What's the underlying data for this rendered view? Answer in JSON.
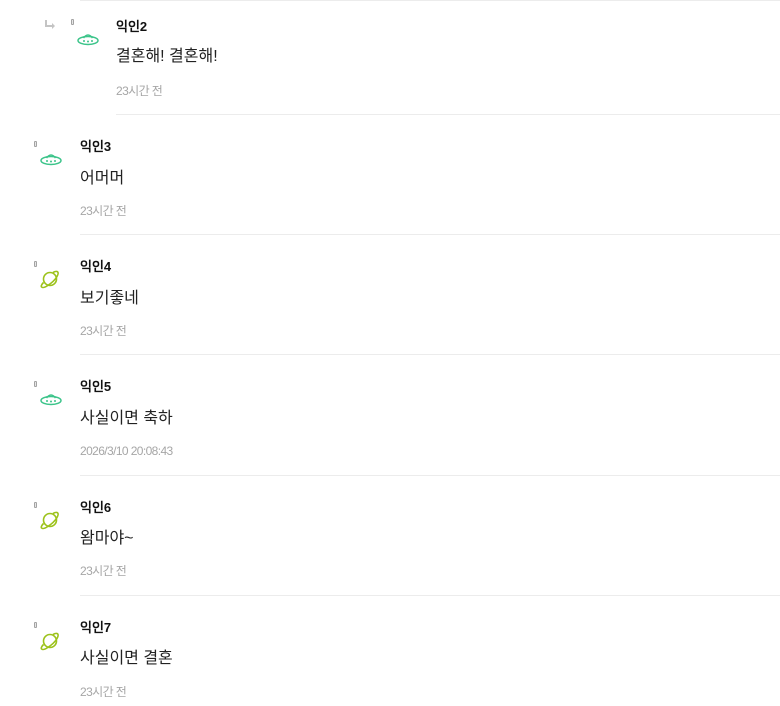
{
  "comments": [
    {
      "author": "익인2",
      "text": "결혼해! 결혼해!",
      "time": "23시간 전",
      "avatar": "ufo-icon",
      "is_reply": true
    },
    {
      "author": "익인3",
      "text": "어머머",
      "time": "23시간 전",
      "avatar": "ufo-icon",
      "is_reply": false
    },
    {
      "author": "익인4",
      "text": "보기좋네",
      "time": "23시간 전",
      "avatar": "planet-icon",
      "is_reply": false
    },
    {
      "author": "익인5",
      "text": "사실이면 축하",
      "time": "2026/3/10 20:08:43",
      "avatar": "ufo-icon",
      "is_reply": false
    },
    {
      "author": "익인6",
      "text": "왐마야~",
      "time": "23시간 전",
      "avatar": "planet-icon",
      "is_reply": false
    },
    {
      "author": "익인7",
      "text": "사실이면 결혼",
      "time": "23시간 전",
      "avatar": "planet-icon",
      "is_reply": false
    }
  ],
  "colors": {
    "ufo": "#3cc48a",
    "planet": "#9cc21a",
    "divider": "#ececec",
    "meta": "#a6a6a6"
  }
}
